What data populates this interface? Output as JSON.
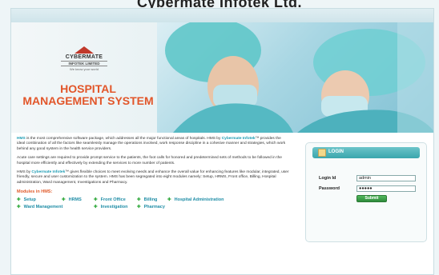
{
  "page": {
    "caption": "Cybermate Infotek Ltd."
  },
  "brand": {
    "company": "CYBERMATE",
    "company_sub": "INFOTEK LIMITED",
    "tagline": "We know your world",
    "app_title_line1": "HOSPITAL",
    "app_title_line2": "MANAGEMENT SYSTEM"
  },
  "intro": {
    "p1_start": "HMS",
    "p1_text": " is the most comprehensive software package, which addresses all the major functional areas of hospitals. HMS by ",
    "p1_company": "Cybermate Infotek",
    "p1_end": "™ provides the ideal combination of all the factors like seamlessly manage the operations involved, work response discipline in a cohesive manner and strategies, which work behind any good system in the health service providers.",
    "p2": "Acute care settings are required to provide prompt service to the patients, the foot calls for honored and predetermined sets of methods to be followed in the hospital more efficiently and effectively by extending the services to more number of patients.",
    "p3_start": "HMS by ",
    "p3_company": "Cybermate Infotek",
    "p3_end": "™ gives flexible choices to meet evolving needs and enhance the overall value for enhancing features like modular, integrated, user friendly, secure and user customization to the system. HMS has been segregated into eight modules namely: Setup, HRMS, Front office, Billing, Hospital administration, Ward management, Investigations and Pharmacy."
  },
  "modules": {
    "title": "Modules in HMS:",
    "items": [
      "Setup",
      "HRMS",
      "Front Office",
      "Billing",
      "Hospital Administration",
      "Ward Management",
      "Investigation",
      "Pharmacy"
    ]
  },
  "login": {
    "title": "LOGIN",
    "login_id_label": "Login Id",
    "login_id_value": "admin",
    "password_label": "Password",
    "password_value": "●●●●●",
    "submit_label": "Submit"
  },
  "colors": {
    "accent_orange": "#e2562a",
    "accent_teal": "#1a9bb3",
    "accent_green": "#2ea83a"
  }
}
